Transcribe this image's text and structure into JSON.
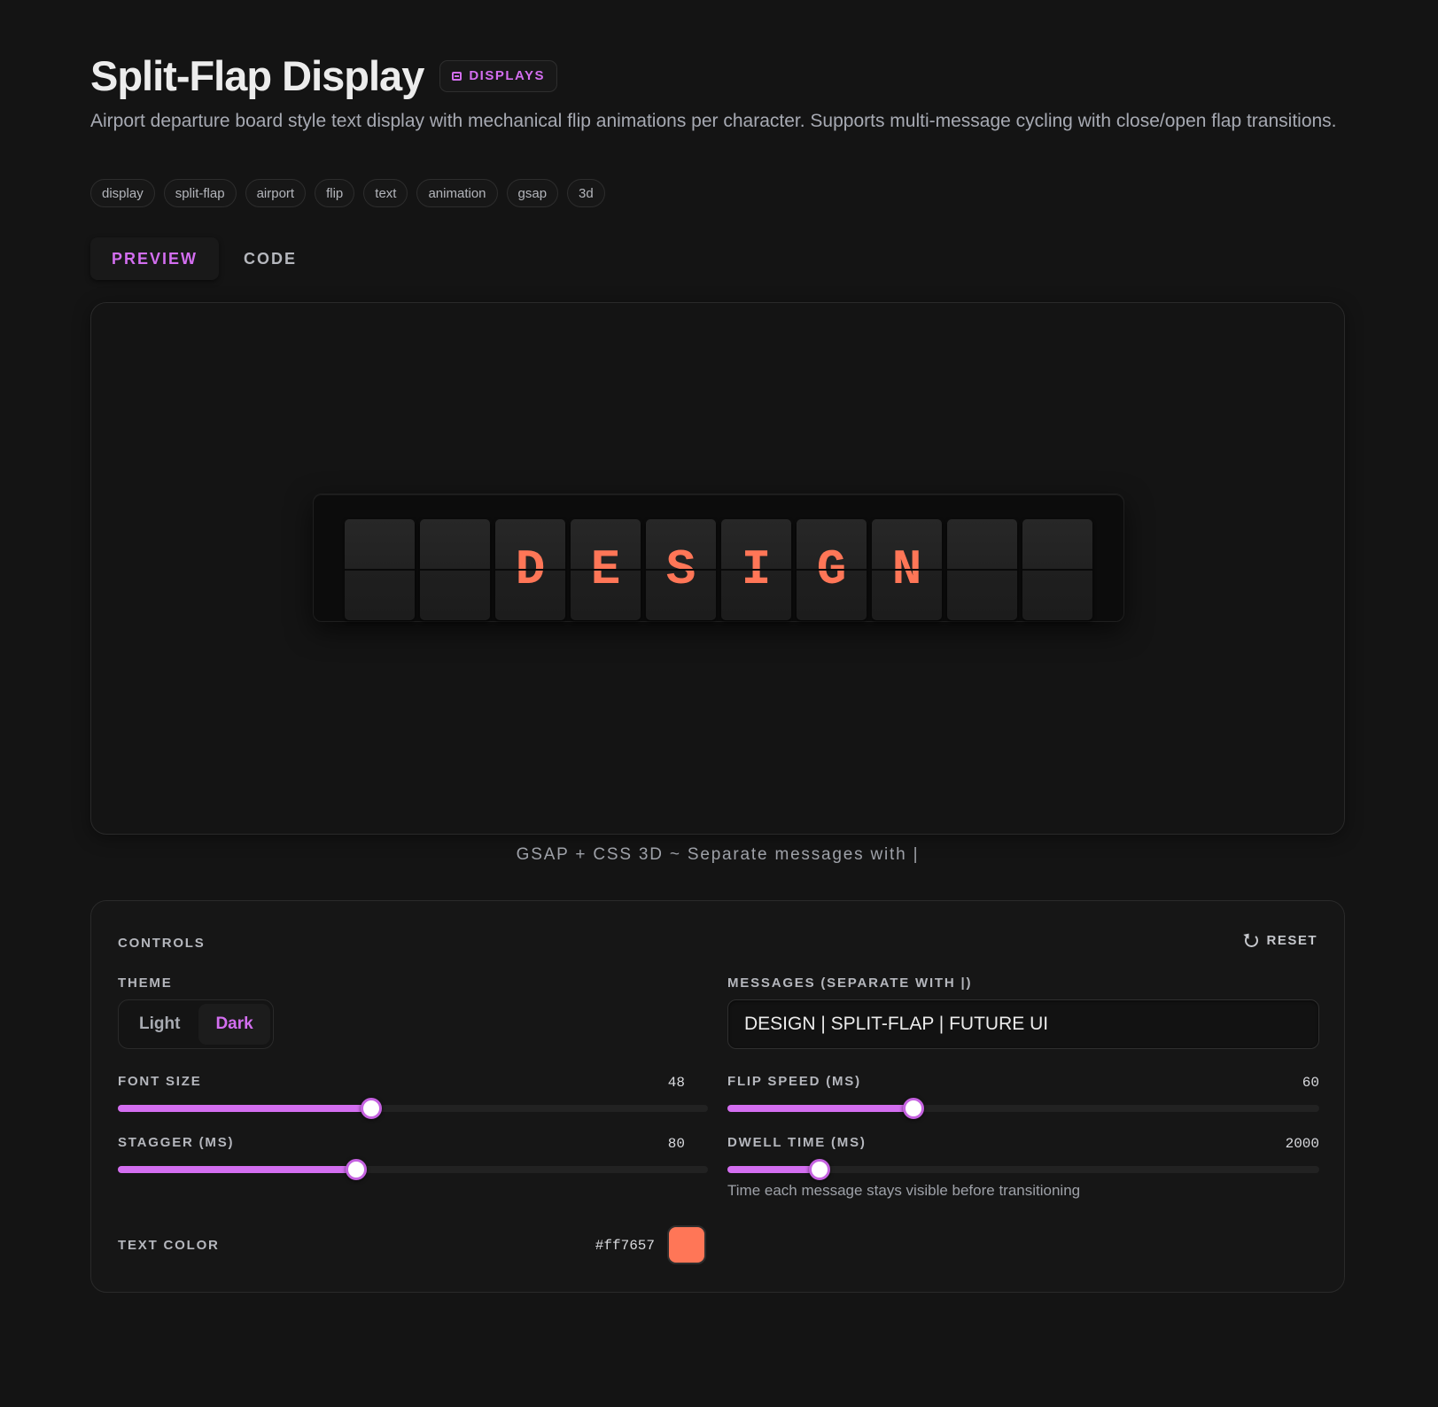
{
  "header": {
    "title": "Split-Flap Display",
    "badge": "DISPLAYS",
    "description": "Airport departure board style text display with mechanical flip animations per character. Supports multi-message cycling with close/open flap transitions.",
    "tags": [
      "display",
      "split-flap",
      "airport",
      "flip",
      "text",
      "animation",
      "gsap",
      "3d"
    ]
  },
  "tabs": [
    {
      "label": "PREVIEW",
      "active": true
    },
    {
      "label": "CODE",
      "active": false
    }
  ],
  "preview": {
    "flaps": [
      "",
      "",
      "D",
      "E",
      "S",
      "I",
      "G",
      "N",
      "",
      ""
    ],
    "caption": "GSAP + CSS 3D ~ Separate messages with |"
  },
  "controls": {
    "title": "CONTROLS",
    "reset_label": "RESET",
    "theme": {
      "label": "THEME",
      "options": [
        "Light",
        "Dark"
      ],
      "selected": "Dark"
    },
    "messages": {
      "label": "MESSAGES (SEPARATE WITH |)",
      "value": "DESIGN | SPLIT-FLAP | FUTURE UI"
    },
    "font_size": {
      "label": "FONT SIZE",
      "value": "48",
      "fraction": 0.43
    },
    "flip_speed": {
      "label": "FLIP SPEED (MS)",
      "value": "60",
      "fraction": 0.315
    },
    "stagger": {
      "label": "STAGGER (MS)",
      "value": "80",
      "fraction": 0.404
    },
    "dwell_time": {
      "label": "DWELL TIME (MS)",
      "value": "2000",
      "fraction": 0.155,
      "hint": "Time each message stays visible before transitioning"
    },
    "text_color": {
      "label": "TEXT COLOR",
      "value": "#ff7657"
    }
  },
  "colors": {
    "accent": "#d36ef0",
    "flap_text": "#ff7657",
    "background": "#141414"
  }
}
